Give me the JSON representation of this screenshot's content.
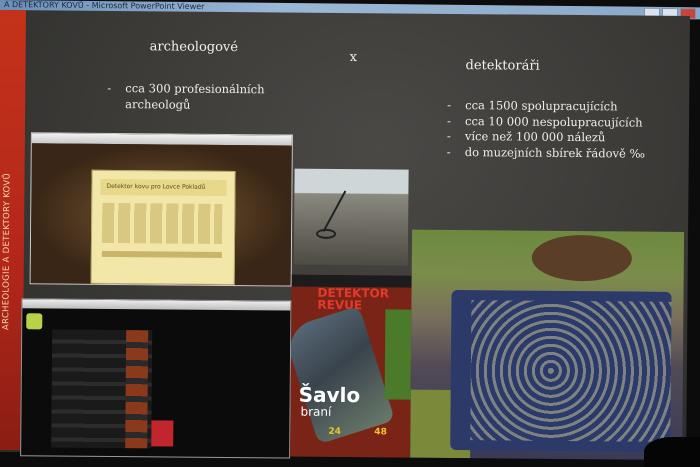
{
  "window": {
    "title": "A DETEKTORY KOVŮ - Microsoft PowerPoint Viewer"
  },
  "slide": {
    "side_title": "ARCHEOLOGIE A DETEKTORY KOVŮ",
    "left_heading": "archeologové",
    "separator": "x",
    "right_heading": "detektoráři",
    "left_bullets": [
      "cca 300 profesionálních archeologů"
    ],
    "right_bullets": [
      "cca 1500 spolupracujících",
      "cca 10 000 nespolupracujících",
      "více než 100 000 nálezů",
      "do muzejních sbírek řádově ‰"
    ]
  },
  "images": {
    "website_title": "Detektor kovu pro Lovce Pokladů",
    "magazine_masthead": "DETEKTOR REVUE",
    "magazine_headline_1": "Šavlo",
    "magazine_headline_2": "braní",
    "magazine_num_1": "24",
    "magazine_num_2": "48"
  }
}
